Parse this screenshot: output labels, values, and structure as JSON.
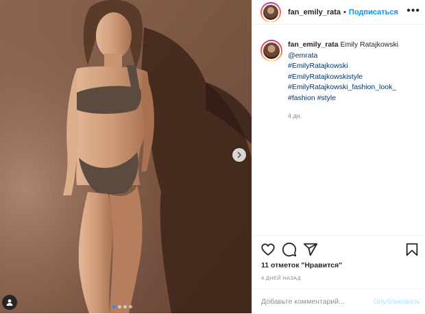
{
  "header": {
    "username": "fan_emily_rata",
    "separator": "•",
    "follow_label": "Подписаться"
  },
  "caption": {
    "username": "fan_emily_rata",
    "name": "Emily Ratajkowski",
    "lines": [
      "@emrata",
      "#EmilyRatajkowski",
      "#EmilyRatajkowskistyle",
      "#EmilyRatajkowski_fashion_look_",
      "#fashion #style"
    ],
    "time": "4 дн."
  },
  "actions": {
    "icons": [
      "heart-icon",
      "comment-icon",
      "share-icon",
      "bookmark-icon"
    ],
    "likes": "11 отметок \"Нравится\"",
    "date": "4 ДНЕЙ НАЗАД"
  },
  "comment": {
    "placeholder": "Добавьте комментарий...",
    "publish_label": "Опубликовать"
  },
  "carousel": {
    "total": 4,
    "current": 1
  },
  "colors": {
    "link": "#00376b",
    "follow": "#0095f6",
    "publish_disabled": "#b2dffc",
    "carousel_active": "#2a8cf4"
  }
}
